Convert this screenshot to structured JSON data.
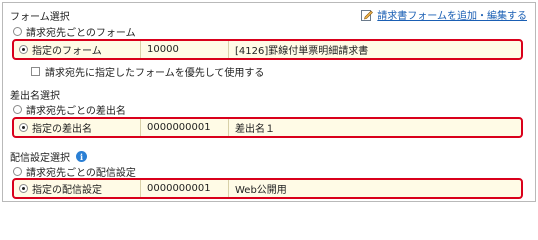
{
  "form_section": {
    "heading": "フォーム選択",
    "add_edit_link": "請求書フォームを追加・編集する",
    "option_per_recipient": "請求宛先ごとのフォーム",
    "selected": {
      "label": "指定のフォーム",
      "code": "10000",
      "name": "[4126]罫線付単票明細請求書"
    },
    "priority_checkbox_label": "請求宛先に指定したフォームを優先して使用する",
    "priority_checked": false
  },
  "sender_section": {
    "heading": "差出名選択",
    "option_per_recipient": "請求宛先ごとの差出名",
    "selected": {
      "label": "指定の差出名",
      "code": "0000000001",
      "name": "差出名１"
    }
  },
  "delivery_section": {
    "heading": "配信設定選択",
    "option_per_recipient": "請求宛先ごとの配信設定",
    "selected": {
      "label": "指定の配信設定",
      "code": "0000000001",
      "name": "Web公開用"
    }
  },
  "colors": {
    "highlight_border": "#d9001b",
    "highlight_fill": "#fffbe6",
    "link": "#1a5fb4",
    "info": "#2a7fd4"
  }
}
